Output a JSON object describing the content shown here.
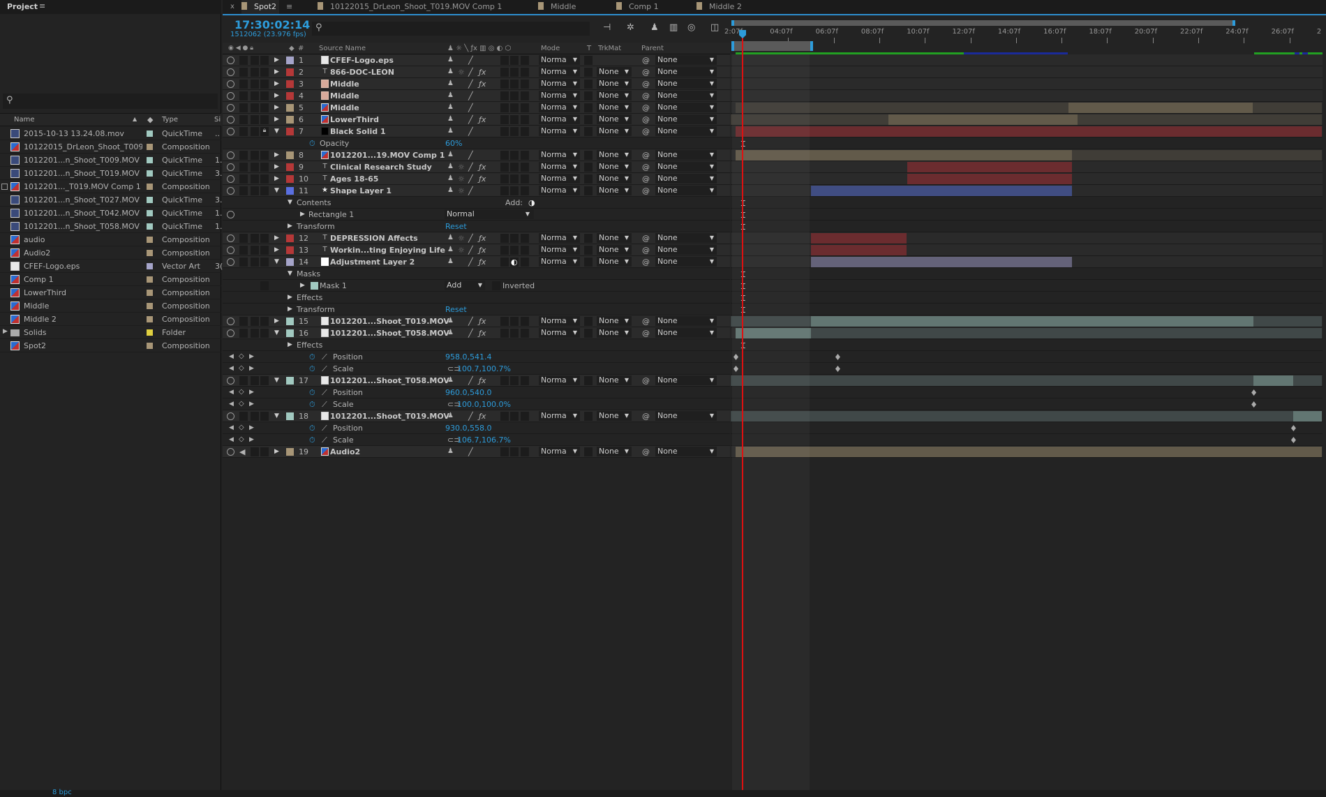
{
  "project": {
    "title": "Project",
    "menu_icon": "hamburger-icon",
    "search_icon": "search-icon",
    "columns": {
      "name": "Name",
      "type": "Type",
      "size": "Si"
    },
    "items": [
      {
        "name": "2015-10-13 13.24.08.mov",
        "icon": "footage",
        "color": "#a1c9c0",
        "type": "QuickTime",
        "size": ".."
      },
      {
        "name": "10122015_DrLeon_Shoot_T009",
        "icon": "comp",
        "color": "#a89677",
        "type": "Composition",
        "size": ""
      },
      {
        "name": "1012201...n_Shoot_T009.MOV",
        "icon": "footage",
        "color": "#a1c9c0",
        "type": "QuickTime",
        "size": "1."
      },
      {
        "name": "1012201...n_Shoot_T019.MOV",
        "icon": "footage",
        "color": "#a1c9c0",
        "type": "QuickTime",
        "size": "3."
      },
      {
        "name": "1012201..._T019.MOV Comp 1",
        "icon": "comp",
        "color": "#a89677",
        "type": "Composition",
        "size": "",
        "selected": true
      },
      {
        "name": "1012201...n_Shoot_T027.MOV",
        "icon": "footage",
        "color": "#a1c9c0",
        "type": "QuickTime",
        "size": "3."
      },
      {
        "name": "1012201...n_Shoot_T042.MOV",
        "icon": "footage",
        "color": "#a1c9c0",
        "type": "QuickTime",
        "size": "1."
      },
      {
        "name": "1012201...n_Shoot_T058.MOV",
        "icon": "footage",
        "color": "#a1c9c0",
        "type": "QuickTime",
        "size": "1."
      },
      {
        "name": "audio",
        "icon": "comp",
        "color": "#a89677",
        "type": "Composition",
        "size": ""
      },
      {
        "name": "Audio2",
        "icon": "comp",
        "color": "#a89677",
        "type": "Composition",
        "size": ""
      },
      {
        "name": "CFEF-Logo.eps",
        "icon": "eps",
        "color": "#a5a4c9",
        "type": "Vector Art",
        "size": "3("
      },
      {
        "name": "Comp 1",
        "icon": "comp",
        "color": "#a89677",
        "type": "Composition",
        "size": ""
      },
      {
        "name": "LowerThird",
        "icon": "comp",
        "color": "#a89677",
        "type": "Composition",
        "size": ""
      },
      {
        "name": "Middle",
        "icon": "comp",
        "color": "#a89677",
        "type": "Composition",
        "size": ""
      },
      {
        "name": "Middle 2",
        "icon": "comp",
        "color": "#a89677",
        "type": "Composition",
        "size": ""
      },
      {
        "name": "Solids",
        "icon": "folder",
        "color": "#e0d040",
        "type": "Folder",
        "size": ""
      },
      {
        "name": "Spot2",
        "icon": "comp",
        "color": "#a89677",
        "type": "Composition",
        "size": ""
      }
    ],
    "bpc": "8 bpc"
  },
  "tabs": {
    "close": "x",
    "active": "Spot2",
    "menu": "≡",
    "others": [
      "10122015_DrLeon_Shoot_T019.MOV Comp 1",
      "Middle",
      "Comp 1",
      "Middle 2"
    ]
  },
  "timeline": {
    "timecode": "17:30:02:14",
    "frame_info": "1512062 (23.976 fps)",
    "columns": {
      "num": "#",
      "source": "Source Name",
      "mode": "Mode",
      "t": "T",
      "trkmat": "TrkMat",
      "parent": "Parent"
    },
    "ticks": [
      "2:07f",
      "04:07f",
      "06:07f",
      "08:07f",
      "10:07f",
      "12:07f",
      "14:07f",
      "16:07f",
      "18:07f",
      "20:07f",
      "22:07f",
      "24:07f",
      "26:07f",
      "2"
    ],
    "current_time_seconds": 2.3,
    "colors": {
      "tan": "#625a4a",
      "tan_dim": "#403d37",
      "red": "#6b2c2f",
      "blue": "#404d82",
      "lav": "#646279",
      "teal": "#627672",
      "teal_dim": "#404848",
      "accent": "#2d9cdb",
      "playhead": "#dd1111"
    }
  },
  "rows": [
    {
      "t": "layer",
      "num": "1",
      "name": "CFEF-Logo.eps",
      "label": "#a5a4c9",
      "src": "eps",
      "sun": false,
      "fx": false,
      "mode": "Norma",
      "trkmat": "",
      "parent": "None",
      "bars": []
    },
    {
      "t": "layer",
      "num": "2",
      "name": "866-DOC-LEON",
      "label": "#b53838",
      "src": "text",
      "sun": true,
      "fx": true,
      "mode": "Norma",
      "trkmat": "None",
      "parent": "None",
      "bars": []
    },
    {
      "t": "layer",
      "num": "3",
      "name": "Middle",
      "label": "#b53838",
      "src": "solid-pink",
      "sun": false,
      "fx": true,
      "mode": "Norma",
      "trkmat": "None",
      "parent": "None",
      "bars": []
    },
    {
      "t": "layer",
      "num": "4",
      "name": "Middle",
      "label": "#b53838",
      "src": "solid-pink",
      "sun": false,
      "fx": false,
      "mode": "Norma",
      "trkmat": "None",
      "parent": "None",
      "bars": []
    },
    {
      "t": "layer",
      "num": "5",
      "name": "Middle",
      "label": "#a89677",
      "src": "comp",
      "sun": false,
      "fx": false,
      "mode": "Norma",
      "trkmat": "None",
      "parent": "None",
      "bars": [
        [
          2.0,
          16.6,
          "tan_dim"
        ],
        [
          16.6,
          24.7,
          "tan"
        ],
        [
          24.7,
          27.8,
          "tan_dim"
        ]
      ]
    },
    {
      "t": "layer",
      "num": "6",
      "name": "LowerThird",
      "label": "#a89677",
      "src": "comp",
      "sun": false,
      "fx": true,
      "mode": "Norma",
      "trkmat": "None",
      "parent": "None",
      "bars": [
        [
          1.6,
          8.7,
          "tan_dim"
        ],
        [
          8.7,
          17.0,
          "tan"
        ],
        [
          17.0,
          27.8,
          "tan_dim"
        ]
      ]
    },
    {
      "t": "layer",
      "num": "7",
      "name": "Black Solid 1",
      "label": "#b53838",
      "src": "solid-black",
      "lock": true,
      "expanded": true,
      "sun": false,
      "fx": false,
      "mode": "Norma",
      "trkmat": "None",
      "parent": "None",
      "bars": [
        [
          2.0,
          27.8,
          "red"
        ]
      ]
    },
    {
      "t": "prop",
      "label": "Opacity",
      "level": 2,
      "stopwatch": true,
      "value": "60%",
      "ibeam": true
    },
    {
      "t": "layer",
      "num": "8",
      "name": "1012201...19.MOV Comp 1",
      "label": "#a89677",
      "src": "comp",
      "sun": false,
      "fx": false,
      "mode": "Norma",
      "trkmat": "None",
      "parent": "None",
      "bars": [
        [
          2.0,
          16.76,
          "tan"
        ],
        [
          16.76,
          27.8,
          "tan_dim"
        ]
      ]
    },
    {
      "t": "layer",
      "num": "9",
      "name": "Clinical  Research Study",
      "label": "#b53838",
      "src": "text",
      "sun": true,
      "fx": true,
      "mode": "Norma",
      "trkmat": "None",
      "parent": "None",
      "bars": [
        [
          9.53,
          16.76,
          "red"
        ]
      ]
    },
    {
      "t": "layer",
      "num": "10",
      "name": "Ages 18-65",
      "label": "#b53838",
      "src": "text",
      "sun": true,
      "fx": true,
      "mode": "Norma",
      "trkmat": "None",
      "parent": "None",
      "bars": [
        [
          9.53,
          16.76,
          "red"
        ]
      ]
    },
    {
      "t": "layer",
      "num": "11",
      "name": "Shape Layer 1",
      "label": "#5a6fe0",
      "src": "star",
      "expanded": true,
      "sun": true,
      "fx": false,
      "mode": "Norma",
      "trkmat": "None",
      "parent": "None",
      "bars": [
        [
          5.3,
          16.76,
          "blue"
        ]
      ]
    },
    {
      "t": "prop",
      "label": "Contents",
      "level": 1,
      "twirl": "down",
      "add": "Add:",
      "ibeam": true
    },
    {
      "t": "prop",
      "label": "Rectangle 1",
      "level": 1.5,
      "twirl": "right",
      "eye": true,
      "dropdown": "Normal",
      "ibeam": true
    },
    {
      "t": "prop",
      "label": "Transform",
      "level": 1,
      "twirl": "right",
      "value": "Reset",
      "ibeam": true
    },
    {
      "t": "layer",
      "num": "12",
      "name": "DEPRESSION Affects",
      "label": "#b53838",
      "src": "text",
      "sun": true,
      "fx": true,
      "mode": "Norma",
      "trkmat": "None",
      "parent": "None",
      "bars": [
        [
          5.3,
          9.5,
          "red"
        ]
      ]
    },
    {
      "t": "layer",
      "num": "13",
      "name": "Workin...ting Enjoying Life",
      "label": "#b53838",
      "src": "text",
      "sun": true,
      "fx": true,
      "mode": "Norma",
      "trkmat": "None",
      "parent": "None",
      "bars": [
        [
          5.3,
          9.5,
          "red"
        ]
      ]
    },
    {
      "t": "layer",
      "num": "14",
      "name": "Adjustment Layer 2",
      "label": "#a5a4c9",
      "src": "solid-white",
      "expanded": true,
      "adjustment": true,
      "sun": false,
      "fx": true,
      "mode": "Norma",
      "trkmat": "None",
      "parent": "None",
      "bars": [
        [
          5.3,
          16.76,
          "lav"
        ]
      ]
    },
    {
      "t": "prop",
      "label": "Masks",
      "level": 1,
      "twirl": "down",
      "ibeam": true
    },
    {
      "t": "prop",
      "label": "Mask 1",
      "level": 1.5,
      "twirl": "right",
      "swatch": "#a1c9c0",
      "maskmode": "Add",
      "inverted": "Inverted",
      "ibeam": true
    },
    {
      "t": "prop",
      "label": "Effects",
      "level": 1,
      "twirl": "right",
      "ibeam": true
    },
    {
      "t": "prop",
      "label": "Transform",
      "level": 1,
      "twirl": "right",
      "value": "Reset",
      "ibeam": true
    },
    {
      "t": "layer",
      "num": "15",
      "name": "1012201...Shoot_T019.MOV",
      "label": "#a1c9c0",
      "src": "footage",
      "sun": false,
      "fx": true,
      "mode": "Norma",
      "trkmat": "None",
      "parent": "None",
      "bars": [
        [
          1.6,
          5.3,
          "teal_dim"
        ],
        [
          5.3,
          24.73,
          "teal"
        ],
        [
          24.73,
          27.8,
          "teal_dim"
        ]
      ]
    },
    {
      "t": "layer",
      "num": "16",
      "name": "1012201...Shoot_T058.MOV",
      "label": "#a1c9c0",
      "src": "footage",
      "expanded": true,
      "sun": false,
      "fx": true,
      "mode": "Norma",
      "trkmat": "None",
      "parent": "None",
      "bars": [
        [
          2.0,
          5.3,
          "teal"
        ],
        [
          5.3,
          27.8,
          "teal_dim"
        ]
      ]
    },
    {
      "t": "prop",
      "label": "Effects",
      "level": 1,
      "twirl": "right",
      "ibeam": true
    },
    {
      "t": "prop",
      "label": "Position",
      "level": 2,
      "nav": true,
      "stopwatch": true,
      "graph": true,
      "value": "958.0,541.4",
      "keys": [
        2.0,
        6.47
      ]
    },
    {
      "t": "prop",
      "label": "Scale",
      "level": 2,
      "nav": true,
      "stopwatch": true,
      "graph": true,
      "link": true,
      "value": "100.7,100.7%",
      "keys": [
        2.0,
        6.47
      ]
    },
    {
      "t": "layer",
      "num": "17",
      "name": "1012201...Shoot_T058.MOV",
      "label": "#a1c9c0",
      "src": "footage",
      "expanded": true,
      "sun": false,
      "fx": true,
      "mode": "Norma",
      "trkmat": "None",
      "parent": "None",
      "bars": [
        [
          1.6,
          24.73,
          "teal_dim"
        ],
        [
          24.73,
          26.47,
          "teal"
        ],
        [
          26.47,
          27.8,
          "teal_dim"
        ]
      ]
    },
    {
      "t": "prop",
      "label": "Position",
      "level": 2,
      "nav": true,
      "stopwatch": true,
      "graph": true,
      "value": "960.0,540.0",
      "keys": [
        24.73
      ]
    },
    {
      "t": "prop",
      "label": "Scale",
      "level": 2,
      "nav": true,
      "stopwatch": true,
      "graph": true,
      "link": true,
      "value": "100.0,100.0%",
      "keys": [
        24.73
      ]
    },
    {
      "t": "layer",
      "num": "18",
      "name": "1012201...Shoot_T019.MOV",
      "label": "#a1c9c0",
      "src": "footage",
      "expanded": true,
      "sun": false,
      "fx": true,
      "mode": "Norma",
      "trkmat": "None",
      "parent": "None",
      "bars": [
        [
          1.6,
          26.47,
          "teal_dim"
        ],
        [
          26.47,
          27.8,
          "teal"
        ]
      ]
    },
    {
      "t": "prop",
      "label": "Position",
      "level": 2,
      "nav": true,
      "stopwatch": true,
      "graph": true,
      "value": "930.0,558.0",
      "keys": [
        26.47
      ]
    },
    {
      "t": "prop",
      "label": "Scale",
      "level": 2,
      "nav": true,
      "stopwatch": true,
      "graph": true,
      "link": true,
      "value": "106.7,106.7%",
      "keys": [
        26.47
      ]
    },
    {
      "t": "layer",
      "num": "19",
      "name": "Audio2",
      "label": "#a89677",
      "src": "comp",
      "audio": true,
      "sun": false,
      "fx": false,
      "mode": "Norma",
      "trkmat": "None",
      "parent": "None",
      "bars": [
        [
          2.0,
          27.8,
          "tan"
        ]
      ]
    }
  ]
}
